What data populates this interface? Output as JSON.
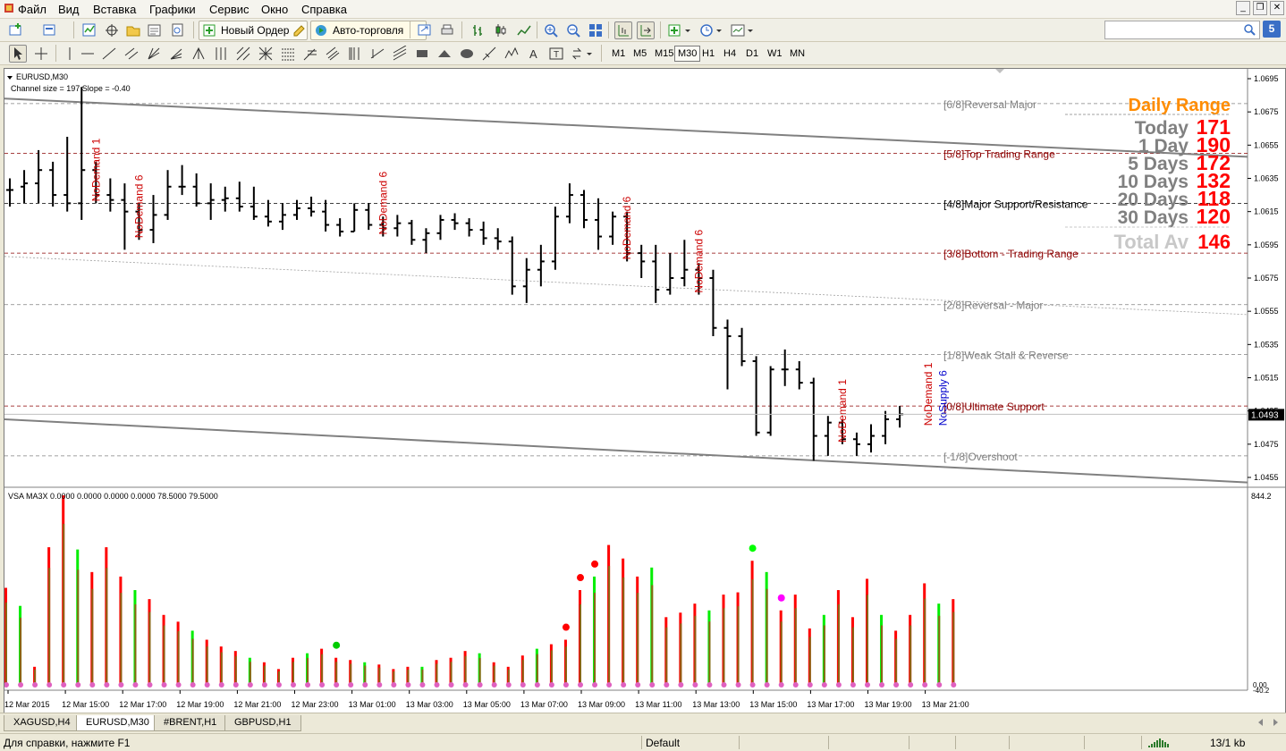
{
  "menu": {
    "items": [
      "Файл",
      "Вид",
      "Вставка",
      "Графики",
      "Сервис",
      "Окно",
      "Справка"
    ]
  },
  "toolbar": {
    "new_order_label": "Новый Ордер",
    "autotrading_label": "Авто-торговля"
  },
  "search": {
    "placeholder": "",
    "badge": "5"
  },
  "timeframes": {
    "items": [
      "M1",
      "M5",
      "M15",
      "M30",
      "H1",
      "H4",
      "D1",
      "W1",
      "MN"
    ],
    "active": "M30"
  },
  "chart": {
    "symbol_label": "EURUSD,M30",
    "channel_info": "Channel size = 197 Slope = -0.40",
    "current_price": "1.0493",
    "price_axis": [
      "1.0695",
      "1.0675",
      "1.0655",
      "1.0635",
      "1.0615",
      "1.0595",
      "1.0575",
      "1.0555",
      "1.0535",
      "1.0515",
      "1.0495",
      "1.0475",
      "1.0455"
    ],
    "murrey_levels": [
      {
        "label": "[6/8]Reversal Major",
        "price": 1.068,
        "color": "#808080",
        "dash": "4,3"
      },
      {
        "label": "[5/8]Top Trading Range",
        "price": 1.065,
        "color": "#8b0000",
        "dash": "4,3"
      },
      {
        "label": "[4/8]Major Support/Resistance",
        "price": 1.062,
        "color": "#000000",
        "dash": "4,3"
      },
      {
        "label": "[3/8]Bottom - Trading Range",
        "price": 1.059,
        "color": "#8b0000",
        "dash": "4,3"
      },
      {
        "label": "[2/8]Reversal - Major",
        "price": 1.0559,
        "color": "#808080",
        "dash": "4,3"
      },
      {
        "label": "[1/8]Weak Stall & Reverse",
        "price": 1.0529,
        "color": "#808080",
        "dash": "4,3"
      },
      {
        "label": "[0/8]Ultimate Support",
        "price": 1.0498,
        "color": "#8b0000",
        "dash": "4,3"
      },
      {
        "label": "[-1/8]Overshoot",
        "price": 1.0468,
        "color": "#808080",
        "dash": "4,3"
      }
    ],
    "daily_range": {
      "title": "Daily Range",
      "rows": [
        {
          "label": "Today",
          "value": "171"
        },
        {
          "label": "1 Day",
          "value": "190"
        },
        {
          "label": "5 Days",
          "value": "172"
        },
        {
          "label": "10 Days",
          "value": "132"
        },
        {
          "label": "20 Days",
          "value": "118"
        },
        {
          "label": "30 Days",
          "value": "120"
        }
      ],
      "total_label": "Total Av",
      "total_value": "146"
    },
    "annotations": [
      {
        "text": "NoDemand 1",
        "bar": 6,
        "color": "#cc0000"
      },
      {
        "text": "NoDemand 6",
        "bar": 9,
        "color": "#cc0000"
      },
      {
        "text": "NoDemand 6",
        "bar": 26,
        "color": "#cc0000"
      },
      {
        "text": "NoDemand 6",
        "bar": 43,
        "color": "#cc0000"
      },
      {
        "text": "NoDemand 6",
        "bar": 48,
        "color": "#cc0000"
      },
      {
        "text": "NoDemand 1",
        "bar": 58,
        "color": "#cc0000"
      },
      {
        "text": "NoDemand 1",
        "bar": 64,
        "color": "#cc0000"
      },
      {
        "text": "NoSupply 6",
        "bar": 65,
        "color": "#0000cc"
      }
    ],
    "time_axis": [
      "12 Mar 2015",
      "12 Mar 15:00",
      "12 Mar 17:00",
      "12 Mar 19:00",
      "12 Mar 21:00",
      "12 Mar 23:00",
      "13 Mar 01:00",
      "13 Mar 03:00",
      "13 Mar 05:00",
      "13 Mar 07:00",
      "13 Mar 09:00",
      "13 Mar 11:00",
      "13 Mar 13:00",
      "13 Mar 15:00",
      "13 Mar 17:00",
      "13 Mar 19:00",
      "13 Mar 21:00"
    ],
    "volume_indicator": {
      "label": "VSA MA3X 0.0000 0.0000 0.0000 0.0000 78.5000 79.5000",
      "axis_top": "844.2",
      "axis_zero": "0.00",
      "axis_neg": "-40.2"
    }
  },
  "chart_data": {
    "type": "candlestick",
    "ohlc": [
      [
        1.0628,
        1.0635,
        1.0618,
        1.0628
      ],
      [
        1.063,
        1.064,
        1.062,
        1.0632
      ],
      [
        1.0632,
        1.0652,
        1.062,
        1.064
      ],
      [
        1.064,
        1.0645,
        1.0618,
        1.0625
      ],
      [
        1.0625,
        1.066,
        1.0615,
        1.062
      ],
      [
        1.062,
        1.069,
        1.061,
        1.064
      ],
      [
        1.064,
        1.0645,
        1.062,
        1.0625
      ],
      [
        1.0625,
        1.0635,
        1.0615,
        1.0622
      ],
      [
        1.0622,
        1.0632,
        1.0592,
        1.0615
      ],
      [
        1.0615,
        1.062,
        1.0598,
        1.0604
      ],
      [
        1.0604,
        1.0625,
        1.0596,
        1.0613
      ],
      [
        1.0613,
        1.064,
        1.061,
        1.063
      ],
      [
        1.063,
        1.0643,
        1.0625,
        1.063
      ],
      [
        1.063,
        1.0638,
        1.0618,
        1.062
      ],
      [
        1.062,
        1.0632,
        1.061,
        1.0622
      ],
      [
        1.0622,
        1.063,
        1.0615,
        1.0623
      ],
      [
        1.0623,
        1.0633,
        1.0615,
        1.0618
      ],
      [
        1.0618,
        1.063,
        1.061,
        1.0612
      ],
      [
        1.0612,
        1.0622,
        1.0606,
        1.0609
      ],
      [
        1.0609,
        1.062,
        1.0604,
        1.0613
      ],
      [
        1.0613,
        1.0622,
        1.061,
        1.0617
      ],
      [
        1.0617,
        1.0624,
        1.0612,
        1.0615
      ],
      [
        1.0615,
        1.0622,
        1.0603,
        1.0607
      ],
      [
        1.0607,
        1.0611,
        1.06,
        1.0603
      ],
      [
        1.0603,
        1.062,
        1.0603,
        1.0616
      ],
      [
        1.0616,
        1.062,
        1.0604,
        1.0607
      ],
      [
        1.0607,
        1.0612,
        1.06,
        1.0605
      ],
      [
        1.0605,
        1.0613,
        1.06,
        1.0608
      ],
      [
        1.0608,
        1.061,
        1.0595,
        1.0598
      ],
      [
        1.0598,
        1.0605,
        1.059,
        1.0602
      ],
      [
        1.0602,
        1.0613,
        1.0598,
        1.061
      ],
      [
        1.061,
        1.0614,
        1.0604,
        1.0608
      ],
      [
        1.0608,
        1.0611,
        1.06,
        1.0604
      ],
      [
        1.0604,
        1.0609,
        1.0595,
        1.0599
      ],
      [
        1.0599,
        1.0605,
        1.0592,
        1.0597
      ],
      [
        1.0597,
        1.06,
        1.0565,
        1.057
      ],
      [
        1.057,
        1.0587,
        1.056,
        1.058
      ],
      [
        1.058,
        1.0595,
        1.057,
        1.0585
      ],
      [
        1.0585,
        1.0618,
        1.058,
        1.0612
      ],
      [
        1.0612,
        1.0632,
        1.0608,
        1.0625
      ],
      [
        1.0625,
        1.0628,
        1.0605,
        1.061
      ],
      [
        1.061,
        1.0623,
        1.0592,
        1.06
      ],
      [
        1.06,
        1.0615,
        1.0595,
        1.0612
      ],
      [
        1.0612,
        1.0615,
        1.0585,
        1.059
      ],
      [
        1.059,
        1.0595,
        1.0575,
        1.0585
      ],
      [
        1.0585,
        1.0595,
        1.056,
        1.0568
      ],
      [
        1.0568,
        1.059,
        1.0565,
        1.0575
      ],
      [
        1.0575,
        1.0598,
        1.057,
        1.058
      ],
      [
        1.058,
        1.0584,
        1.0565,
        1.0575
      ],
      [
        1.0575,
        1.058,
        1.054,
        1.0545
      ],
      [
        1.0545,
        1.055,
        1.0508,
        1.054
      ],
      [
        1.054,
        1.0545,
        1.0522,
        1.0525
      ],
      [
        1.0525,
        1.0528,
        1.048,
        1.0482
      ],
      [
        1.0482,
        1.0522,
        1.048,
        1.052
      ],
      [
        1.052,
        1.0532,
        1.051,
        1.052
      ],
      [
        1.052,
        1.0525,
        1.0508,
        1.0512
      ],
      [
        1.0512,
        1.0515,
        1.0465,
        1.048
      ],
      [
        1.048,
        1.0492,
        1.0468,
        1.0488
      ],
      [
        1.0488,
        1.049,
        1.0475,
        1.0478
      ],
      [
        1.0478,
        1.0482,
        1.0468,
        1.0475
      ],
      [
        1.0475,
        1.0487,
        1.047,
        1.048
      ],
      [
        1.048,
        1.0495,
        1.0475,
        1.049
      ],
      [
        1.049,
        1.0498,
        1.0485,
        1.0493
      ]
    ],
    "volume": [
      430,
      350,
      80,
      610,
      840,
      600,
      500,
      610,
      480,
      420,
      380,
      310,
      280,
      240,
      200,
      170,
      150,
      120,
      100,
      70,
      120,
      140,
      160,
      120,
      110,
      100,
      90,
      70,
      80,
      80,
      110,
      120,
      150,
      140,
      100,
      80,
      130,
      160,
      180,
      200,
      420,
      480,
      620,
      560,
      480,
      520,
      300,
      320,
      360,
      330,
      400,
      410,
      550,
      500,
      330,
      400,
      250,
      310,
      420,
      300,
      470,
      310,
      240,
      310,
      450,
      360,
      380,
      300,
      380,
      500,
      280,
      280,
      240,
      240
    ],
    "ylim": [
      1.045,
      1.07
    ]
  },
  "tabs": {
    "items": [
      "XAGUSD,H4",
      "EURUSD,M30",
      "#BRENT,H1",
      "GBPUSD,H1"
    ],
    "active": "EURUSD,M30"
  },
  "status": {
    "help": "Для справки, нажмите F1",
    "profile": "Default",
    "traffic": "13/1 kb"
  },
  "colors": {
    "accent": "#ff8c00",
    "value_red": "#ff0000",
    "label_gray": "#808080",
    "vol_red": "#ff0000",
    "vol_green": "#00ff00",
    "vol_body": "#8b4513"
  }
}
